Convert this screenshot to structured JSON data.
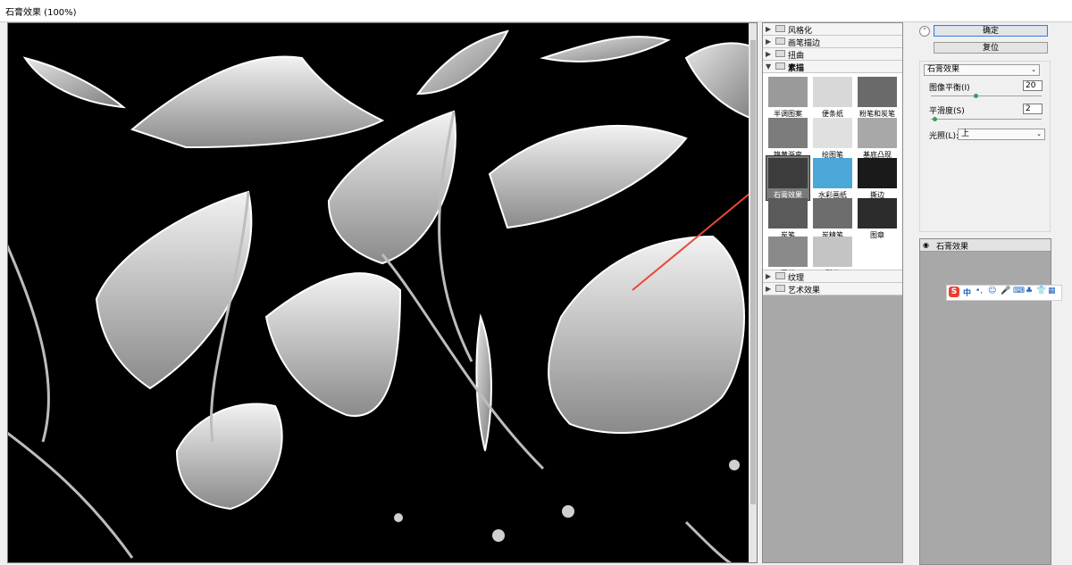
{
  "window": {
    "title": "石膏效果 (100%)"
  },
  "gallery": {
    "categories": [
      {
        "label": "风格化"
      },
      {
        "label": "画笔描边"
      },
      {
        "label": "扭曲"
      },
      {
        "label": "素描"
      },
      {
        "label": "纹理"
      },
      {
        "label": "艺术效果"
      }
    ],
    "filters": [
      "半调图案",
      "便条纸",
      "粉笔和炭笔",
      "铬黄渐变",
      "绘图笔",
      "基底凸现",
      "石膏效果",
      "水彩画纸",
      "撕边",
      "炭笔",
      "炭精笔",
      "图章",
      "网状",
      "影印"
    ]
  },
  "controls": {
    "ok_label": "确定",
    "reset_label": "复位",
    "filter_select": "石膏效果",
    "params": [
      {
        "label": "图像平衡(I)",
        "value": "20"
      },
      {
        "label": "平滑度(S)",
        "value": "2"
      }
    ],
    "light_label": "光照(L):",
    "light_value": "上"
  },
  "layers": {
    "active": "石膏效果"
  },
  "ime": {
    "mode": "中",
    "items": [
      "中",
      "•,",
      "☺",
      "🎤",
      "⌨",
      "♣",
      "👕",
      "▦"
    ]
  }
}
